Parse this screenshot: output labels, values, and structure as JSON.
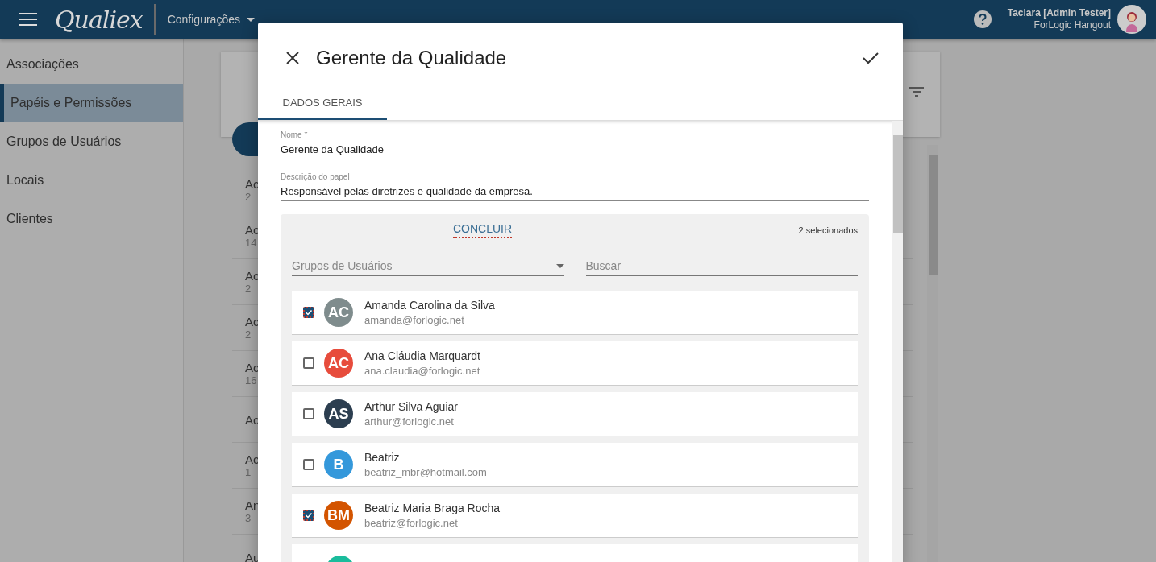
{
  "topbar": {
    "app_name": "Qualiex",
    "menu": "Configurações",
    "user_name": "Taciara [Admin Tester]",
    "user_org": "ForLogic Hangout"
  },
  "sidebar": {
    "items": [
      {
        "label": "Associações",
        "selected": false
      },
      {
        "label": "Papéis e Permissões",
        "selected": true
      },
      {
        "label": "Grupos de Usuários",
        "selected": false
      },
      {
        "label": "Locais",
        "selected": false
      },
      {
        "label": "Clientes",
        "selected": false
      }
    ]
  },
  "background_list": {
    "items": [
      {
        "title": "Ac",
        "subtitle": "2"
      },
      {
        "title": "Ac",
        "subtitle": "14"
      },
      {
        "title": "Ac",
        "subtitle": "2"
      },
      {
        "title": "Ac",
        "subtitle": "2"
      },
      {
        "title": "Ac",
        "subtitle": "16"
      },
      {
        "title": "Ac"
      },
      {
        "title": "Ac",
        "subtitle": "1"
      },
      {
        "title": "An",
        "subtitle": "3"
      },
      {
        "title": "Au"
      }
    ]
  },
  "dialog": {
    "title": "Gerente da Qualidade",
    "tabs": [
      {
        "label": "DADOS GERAIS",
        "selected": true
      }
    ],
    "fields": [
      {
        "label": "Nome *",
        "value": "Gerente da Qualidade"
      },
      {
        "label": "Descrição do papel",
        "value": "Responsável pelas diretrizes e qualidade da empresa."
      }
    ],
    "picker": {
      "action": "CONCLUIR",
      "count": "2 selecionados",
      "group_filter": {
        "placeholder": "Grupos de Usuários"
      },
      "search": {
        "placeholder": "Buscar"
      },
      "users": [
        {
          "kind": "user",
          "name": "Amanda Carolina da Silva",
          "email": "amanda@forlogic.net",
          "initials": "AC",
          "color": "#7f8c8d",
          "checked": true
        },
        {
          "kind": "user",
          "name": "Ana Cláudia Marquardt",
          "email": "ana.claudia@forlogic.net",
          "initials": "AC",
          "color": "#e74c3c",
          "checked": false
        },
        {
          "kind": "user",
          "name": "Arthur Silva Aguiar",
          "email": "arthur@forlogic.net",
          "initials": "AS",
          "color": "#2c3e50",
          "checked": false
        },
        {
          "kind": "user",
          "name": "Beatriz",
          "email": "beatriz_mbr@hotmail.com",
          "initials": "B",
          "color": "#3498db",
          "checked": false
        },
        {
          "kind": "user",
          "name": "Beatriz Maria Braga Rocha",
          "email": "beatriz@forlogic.net",
          "initials": "BM",
          "color": "#d35400",
          "checked": true
        },
        {
          "kind": "partial",
          "color": "#1abc9c"
        }
      ]
    }
  }
}
